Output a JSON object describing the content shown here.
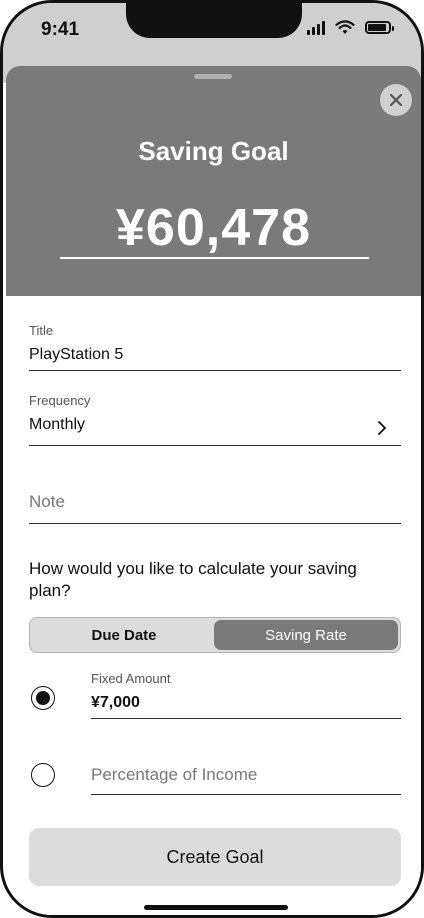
{
  "status_bar": {
    "time": "9:41"
  },
  "sheet": {
    "title": "Saving Goal",
    "amount": "¥60,478"
  },
  "form": {
    "title_field": {
      "label": "Title",
      "value": "PlayStation 5"
    },
    "frequency_field": {
      "label": "Frequency",
      "value": "Monthly"
    },
    "note_field": {
      "placeholder": "Note"
    },
    "question": "How would you like to calculate your saving plan?",
    "segmented": {
      "options": [
        "Due Date",
        "Saving Rate"
      ],
      "selected": "Saving Rate"
    },
    "fixed_amount": {
      "label": "Fixed Amount",
      "value": "¥7,000",
      "selected": true
    },
    "percentage_income": {
      "placeholder": "Percentage of Income",
      "selected": false
    },
    "submit_label": "Create Goal"
  },
  "colors": {
    "header_bg": "#7a7a7a",
    "segment_active": "#7a7a7a",
    "button_bg": "#dcdcdc"
  }
}
